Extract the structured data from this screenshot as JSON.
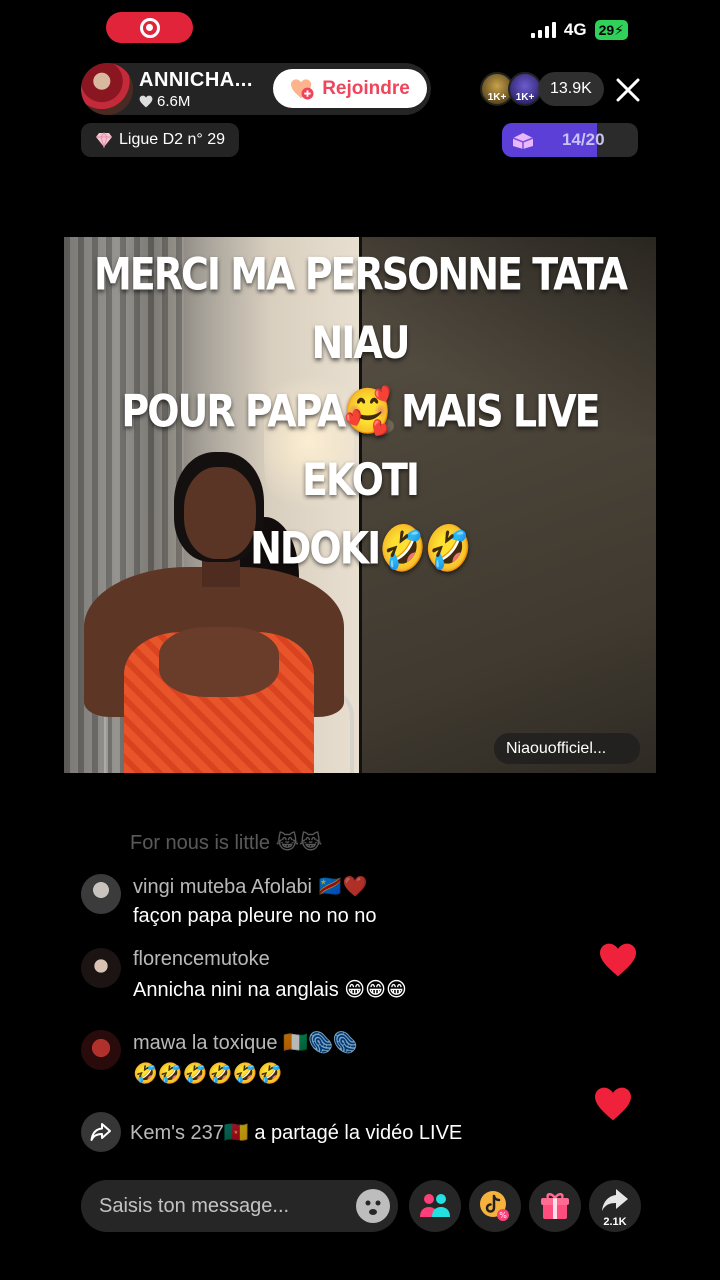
{
  "status_bar": {
    "network": "4G",
    "battery": "29"
  },
  "header": {
    "host_name": "ANNICHA...",
    "host_likes": "6.6M",
    "join_label": "Rejoindre",
    "viewer_badge_1": "1K+",
    "viewer_badge_2": "1K+",
    "viewer_count": "13.9K",
    "league": "Ligue D2 n° 29",
    "goal_text": "14/20",
    "goal_progress": 0.7
  },
  "video": {
    "caption_line1": "Merci ma personne tata niau",
    "caption_line2": "pour papa🥰 mais live ekoti",
    "caption_line3": "ndoki🤣🤣",
    "guest_label": "Niaouofficiel..."
  },
  "comments": {
    "faded": "For nous is little 😹😹",
    "items": [
      {
        "user": "vingi muteba Afolabi 🇨🇩❤️",
        "text": "façon papa pleure no no no"
      },
      {
        "user": "florencemutoke",
        "text": "Annicha nini na anglais 😁😁😁"
      },
      {
        "user": "mawa la toxique 🇨🇮🫆🫆",
        "text": "🤣🤣🤣🤣🤣🤣"
      }
    ],
    "share_user": "Kem's 237🇨🇲",
    "share_text": " a partagé la vidéo LIVE"
  },
  "bottom": {
    "placeholder": "Saisis ton message...",
    "share_count": "2.1K"
  },
  "colors": {
    "accent_red": "#e1243a",
    "join_text": "#f0445a",
    "goal_fill": "#5b3fd6",
    "heart": "#f0213b",
    "battery": "#30d158"
  }
}
